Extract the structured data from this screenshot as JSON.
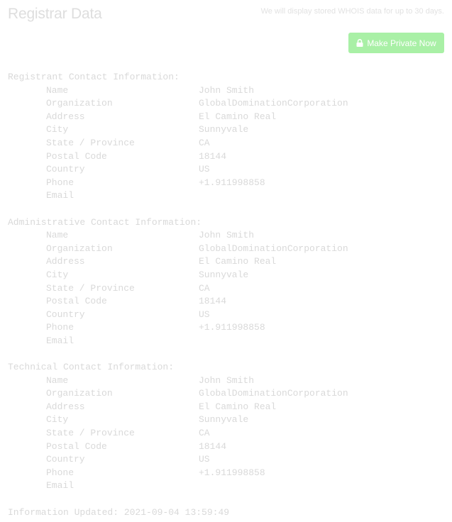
{
  "header": {
    "title": "Registrar Data",
    "retention_note": "We will display stored WHOIS data for up to 30 days.",
    "private_button_label": "Make Private Now",
    "private_button_icon": "lock-icon",
    "button_color": "#a9f0a6"
  },
  "sections": [
    {
      "heading": "Registrant Contact Information:",
      "fields": [
        {
          "label": "Name",
          "value": "John Smith"
        },
        {
          "label": "Organization",
          "value": "GlobalDominationCorporation"
        },
        {
          "label": "Address",
          "value": "El Camino Real"
        },
        {
          "label": "City",
          "value": "Sunnyvale"
        },
        {
          "label": "State / Province",
          "value": "CA"
        },
        {
          "label": "Postal Code",
          "value": "18144"
        },
        {
          "label": "Country",
          "value": "US"
        },
        {
          "label": "Phone",
          "value": "+1.911998858"
        },
        {
          "label": "Email",
          "value": ""
        }
      ]
    },
    {
      "heading": "Administrative Contact Information:",
      "fields": [
        {
          "label": "Name",
          "value": "John Smith"
        },
        {
          "label": "Organization",
          "value": "GlobalDominationCorporation"
        },
        {
          "label": "Address",
          "value": "El Camino Real"
        },
        {
          "label": "City",
          "value": "Sunnyvale"
        },
        {
          "label": "State / Province",
          "value": "CA"
        },
        {
          "label": "Postal Code",
          "value": "18144"
        },
        {
          "label": "Country",
          "value": "US"
        },
        {
          "label": "Phone",
          "value": "+1.911998858"
        },
        {
          "label": "Email",
          "value": ""
        }
      ]
    },
    {
      "heading": "Technical Contact Information:",
      "fields": [
        {
          "label": "Name",
          "value": "John Smith"
        },
        {
          "label": "Organization",
          "value": "GlobalDominationCorporation"
        },
        {
          "label": "Address",
          "value": "El Camino Real"
        },
        {
          "label": "City",
          "value": "Sunnyvale"
        },
        {
          "label": "State / Province",
          "value": "CA"
        },
        {
          "label": "Postal Code",
          "value": "18144"
        },
        {
          "label": "Country",
          "value": "US"
        },
        {
          "label": "Phone",
          "value": "+1.911998858"
        },
        {
          "label": "Email",
          "value": ""
        }
      ]
    }
  ],
  "footer": {
    "updated_line": "Information Updated: 2021-09-04 13:59:49"
  }
}
